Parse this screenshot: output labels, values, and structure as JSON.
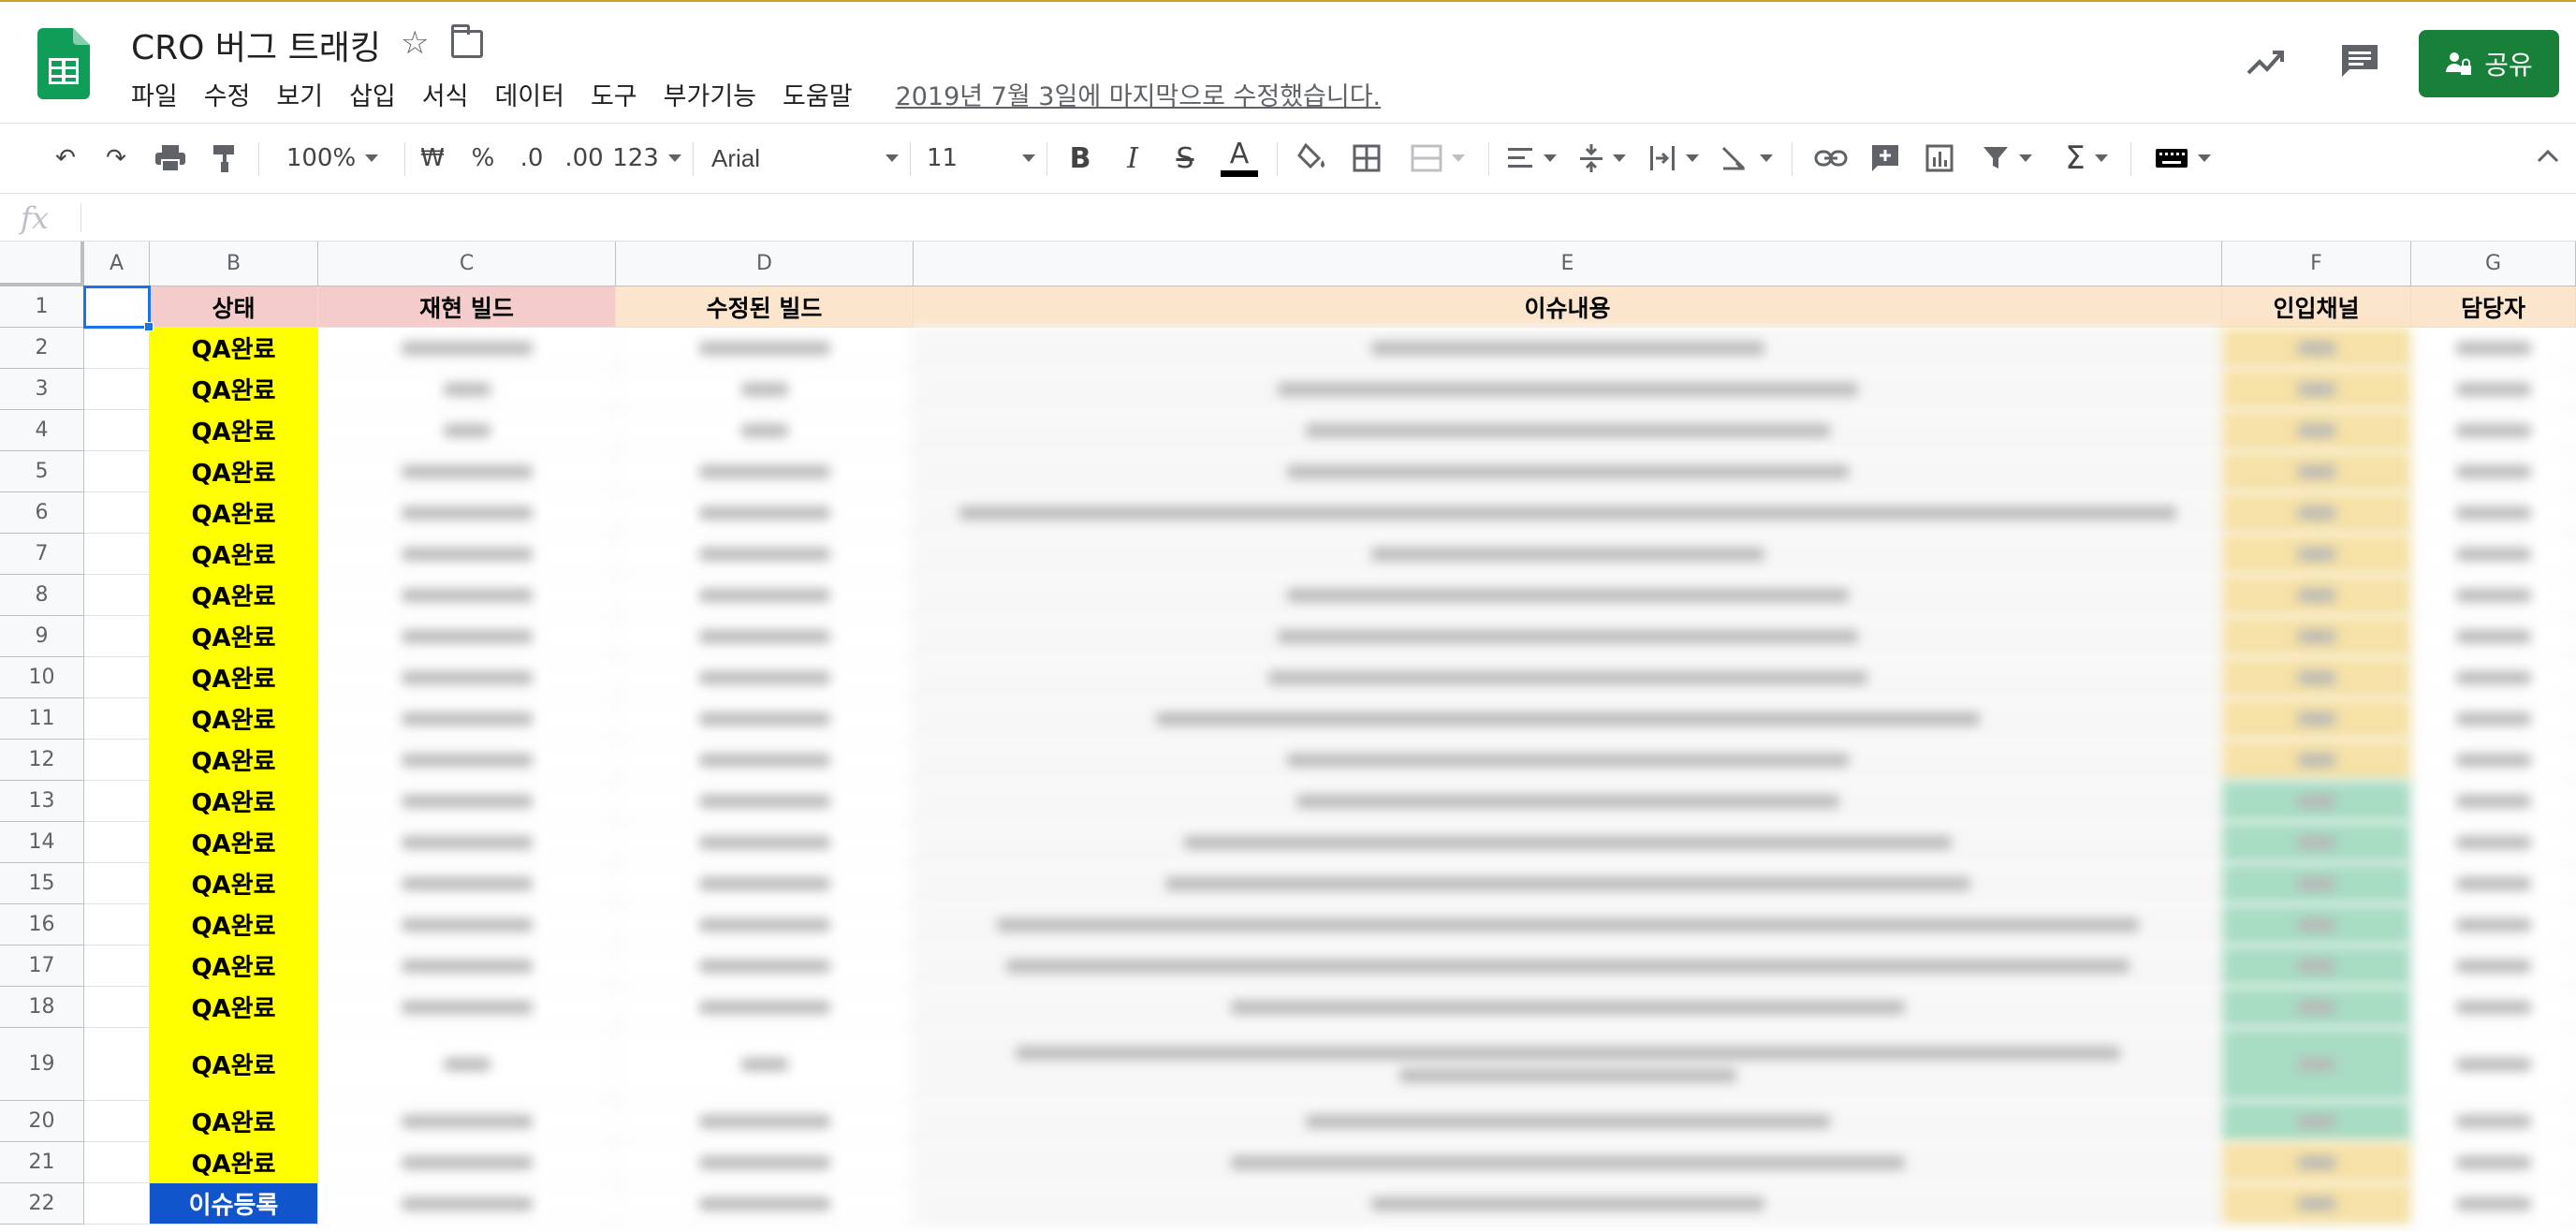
{
  "document": {
    "title": "CRO 버그 트래킹",
    "last_edit": "2019년 7월 3일에 마지막으로 수정했습니다."
  },
  "menu": [
    "파일",
    "수정",
    "보기",
    "삽입",
    "서식",
    "데이터",
    "도구",
    "부가기능",
    "도움말"
  ],
  "share_label": "공유",
  "toolbar": {
    "zoom": "100%",
    "currency": "₩",
    "percent": "%",
    "decimal_decrease": ".0",
    "decimal_increase": ".00",
    "number_format": "123",
    "font": "Arial",
    "font_size": "11",
    "bold": "B",
    "italic": "I",
    "strikethrough": "S",
    "text_color": "A",
    "functions": "Σ"
  },
  "formula_bar": {
    "fx_label": "fx",
    "value": ""
  },
  "colors": {
    "brand_green": "#188038",
    "status_done": "#ffff00",
    "status_registered": "#1155cc",
    "header_red": "#f4cccc",
    "header_orange": "#fce5cd",
    "channel_yellow": "#f6e1a6",
    "channel_green": "#a8dcc3",
    "selection": "#1a73e8"
  },
  "sheet": {
    "columns": [
      "A",
      "B",
      "C",
      "D",
      "E",
      "F",
      "G"
    ],
    "rows": [
      "1",
      "2",
      "3",
      "4",
      "5",
      "6",
      "7",
      "8",
      "9",
      "10",
      "11",
      "12",
      "13",
      "14",
      "15",
      "16",
      "17",
      "18",
      "19",
      "20",
      "21",
      "22"
    ],
    "headers": {
      "status": "상태",
      "repro_build": "재현 빌드",
      "fixed_build": "수정된 빌드",
      "issue": "이슈내용",
      "channel": "인입채널",
      "owner": "담당자"
    },
    "statuses": [
      "QA완료",
      "QA완료",
      "QA완료",
      "QA완료",
      "QA완료",
      "QA완료",
      "QA완료",
      "QA완료",
      "QA완료",
      "QA완료",
      "QA완료",
      "QA완료",
      "QA완료",
      "QA완료",
      "QA완료",
      "QA완료",
      "QA완료",
      "QA완료",
      "QA완료",
      "QA완료",
      "이슈등록"
    ],
    "channel_colors": [
      "yellow",
      "yellow",
      "yellow",
      "yellow",
      "yellow",
      "yellow",
      "yellow",
      "yellow",
      "yellow",
      "yellow",
      "yellow",
      "green",
      "green",
      "green",
      "green",
      "green",
      "green",
      "green",
      "green",
      "yellow",
      "yellow"
    ],
    "selected_cell": "A1"
  }
}
